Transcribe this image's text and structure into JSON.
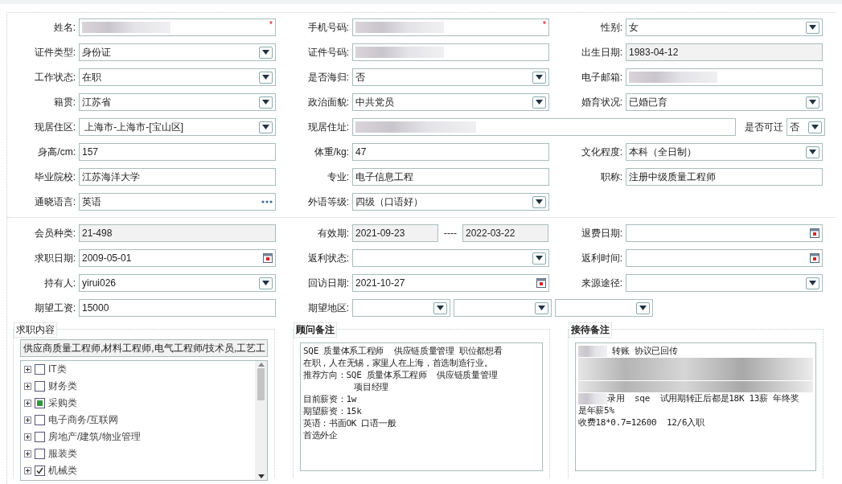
{
  "personal_rows": [
    [
      {
        "label": "姓名:",
        "kind": "text",
        "masked": true,
        "required": "*"
      },
      {
        "label": "手机号码:",
        "kind": "text",
        "masked": true,
        "required": "*"
      },
      {
        "label": "性别:",
        "kind": "select",
        "value": "女"
      }
    ],
    [
      {
        "label": "证件类型:",
        "kind": "select",
        "value": "身份证"
      },
      {
        "label": "证件号码:",
        "kind": "text",
        "masked": true
      },
      {
        "label": "出生日期:",
        "kind": "readonly",
        "value": "1983-04-12"
      }
    ],
    [
      {
        "label": "工作状态:",
        "kind": "select",
        "value": "在职"
      },
      {
        "label": "是否海归:",
        "kind": "select",
        "value": "否"
      },
      {
        "label": "电子邮箱:",
        "kind": "text",
        "masked": true
      }
    ],
    [
      {
        "label": "籍贯:",
        "kind": "select",
        "value": "江苏省"
      },
      {
        "label": "政治面貌:",
        "kind": "select",
        "value": "中共党员"
      },
      {
        "label": "婚育状况:",
        "kind": "select",
        "value": "已婚已育"
      }
    ],
    [
      {
        "label": "现居住区:",
        "kind": "select",
        "value": " 上海市-上海市-[宝山区]"
      },
      {
        "label": "现居住址:",
        "kind": "wide",
        "masked": true,
        "extra_label": "是否可迁",
        "extra_value": "否"
      }
    ],
    [
      {
        "label": "身高/cm:",
        "kind": "text",
        "value": "157"
      },
      {
        "label": "体重/kg:",
        "kind": "text",
        "value": "47"
      },
      {
        "label": "文化程度:",
        "kind": "select",
        "value": "本科（全日制）"
      }
    ],
    [
      {
        "label": "毕业院校:",
        "kind": "text",
        "value": "江苏海洋大学"
      },
      {
        "label": "专业:",
        "kind": "text",
        "value": "电子信息工程"
      },
      {
        "label": "职称:",
        "kind": "text",
        "value": "注册中级质量工程师"
      }
    ],
    [
      {
        "label": "通晓语言:",
        "kind": "lookup",
        "value": "英语"
      },
      {
        "label": "外语等级:",
        "kind": "select",
        "value": "四级（口语好）"
      }
    ]
  ],
  "member_rows": [
    [
      {
        "label": "会员种类:",
        "kind": "readonly",
        "value": "21-498"
      },
      {
        "label": "有效期:",
        "kind": "range",
        "from": "2021-09-23",
        "separator": "----",
        "to": "2022-03-22"
      },
      {
        "label": "退费日期:",
        "kind": "date"
      }
    ],
    [
      {
        "label": "求职日期:",
        "kind": "date",
        "value": "2009-05-01"
      },
      {
        "label": "返利状态:",
        "kind": "select"
      },
      {
        "label": "返利时间:",
        "kind": "date"
      }
    ],
    [
      {
        "label": "持有人:",
        "kind": "select",
        "value": "yirui026"
      },
      {
        "label": "回访日期:",
        "kind": "date",
        "value": "2021-10-27"
      },
      {
        "label": "来源途径:",
        "kind": "select"
      }
    ],
    [
      {
        "label": "期望工资:",
        "kind": "text",
        "value": "15000"
      },
      {
        "label": "期望地区:",
        "kind": "triple"
      }
    ]
  ],
  "job_content": {
    "title": "求职内容",
    "summary": "供应商质量工程师,材料工程师,电气工程师/技术员,工艺工",
    "categories": [
      {
        "label": "IT类",
        "checked": false
      },
      {
        "label": "财务类",
        "checked": false
      },
      {
        "label": "采购类",
        "checked": false,
        "partial": true
      },
      {
        "label": "电子商务/互联网",
        "checked": false
      },
      {
        "label": "房地产/建筑/物业管理",
        "checked": false
      },
      {
        "label": "服装类",
        "checked": false
      },
      {
        "label": "机械类",
        "checked": true
      }
    ]
  },
  "advisor_notes": {
    "title": "顾问备注",
    "lines": [
      {
        "text": "SQE 质量体系工程师  供应链质量管理 职位都想看"
      },
      {
        "text": "在职，人在无锡，家里人在上海，首选制造行业。"
      },
      {
        "text": "推荐方向：SQE 质量体系工程师  供应链质量管理"
      },
      {
        "text": "          项目经理"
      },
      {
        "text": "目前薪资：1w"
      },
      {
        "text": "期望薪资：15k"
      },
      {
        "text": "英语：书面OK 口语一般"
      },
      {
        "text": "首选外企"
      }
    ]
  },
  "reception_notes": {
    "title": "接待备注",
    "lines": [
      {
        "masked_prefix": true,
        "text": " 转账 协议已回传"
      },
      {
        "kind": "masked"
      },
      {
        "kind": "masked"
      },
      {
        "kind": "masked"
      },
      {
        "masked_prefix": true,
        "text": "录用  sqe  试用期转正后都是18K 13薪 年终奖"
      },
      {
        "text": "是年薪5%"
      },
      {
        "text": "收费18*0.7=12600  12/6入职"
      }
    ]
  }
}
